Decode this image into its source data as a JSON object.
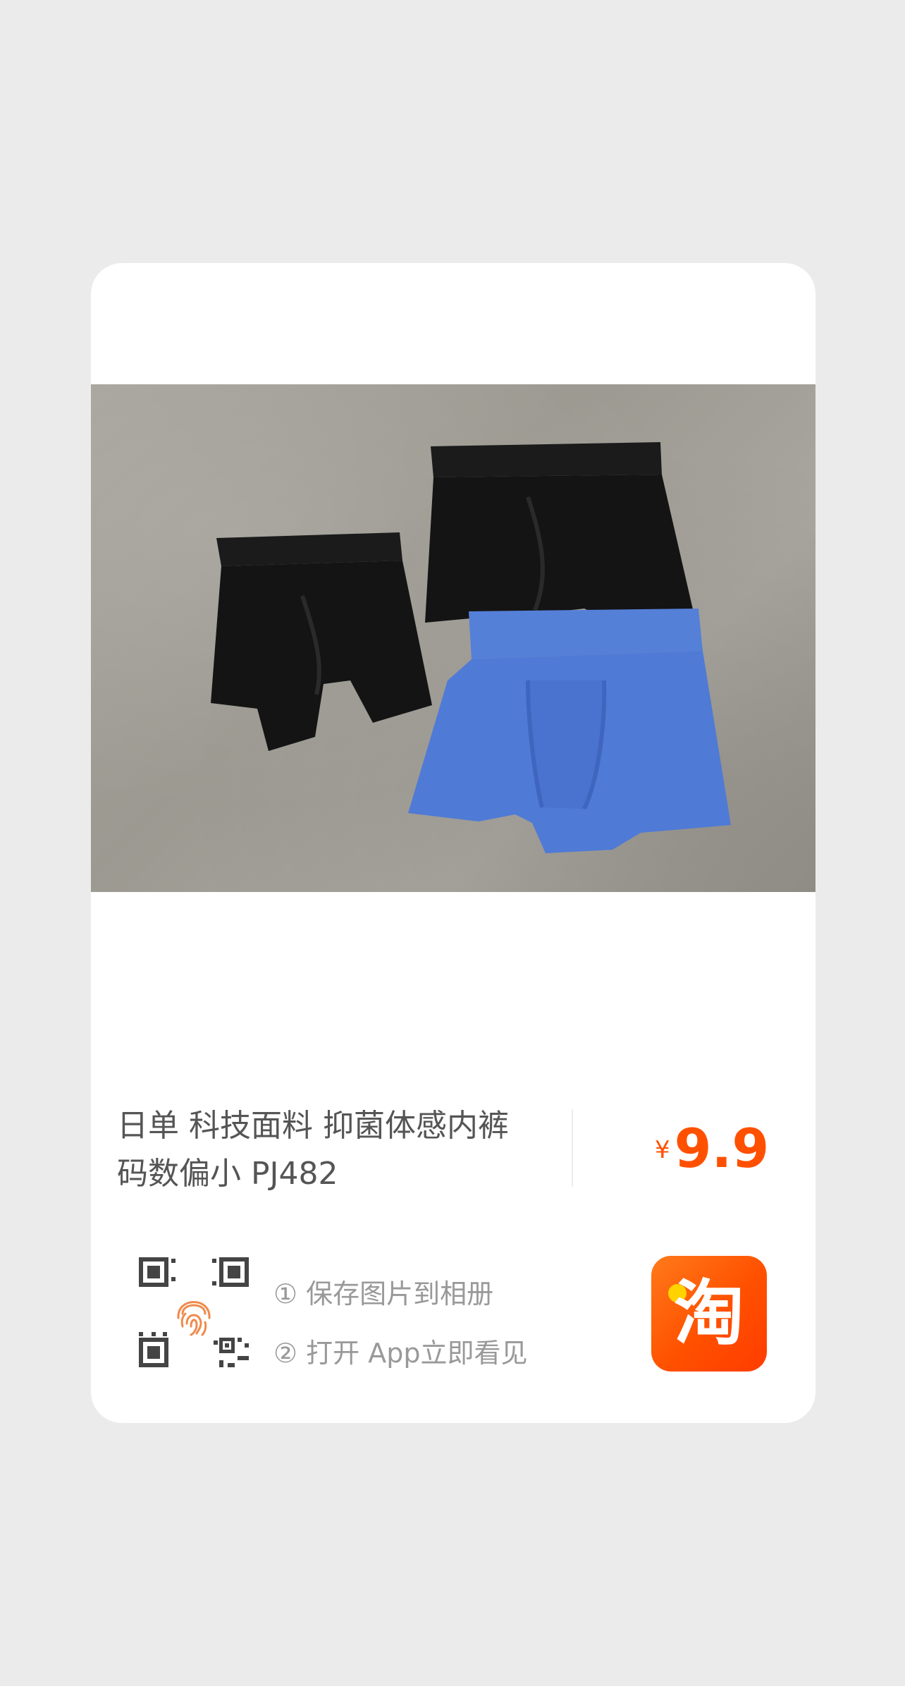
{
  "product": {
    "title": "日单 科技面料 抑菌体感内裤 码数偏小 PJ482",
    "price_currency": "¥",
    "price_value": "9.9"
  },
  "instructions": {
    "step1": "① 保存图片到相册",
    "step2": "② 打开 App立即看见"
  },
  "app": {
    "icon_glyph": "淘",
    "icon_name": "taobao-app-icon"
  },
  "colors": {
    "accent": "#ff5000",
    "background": "#ebebeb",
    "card": "#ffffff",
    "title_text": "#555555",
    "hint_text": "#999999"
  }
}
